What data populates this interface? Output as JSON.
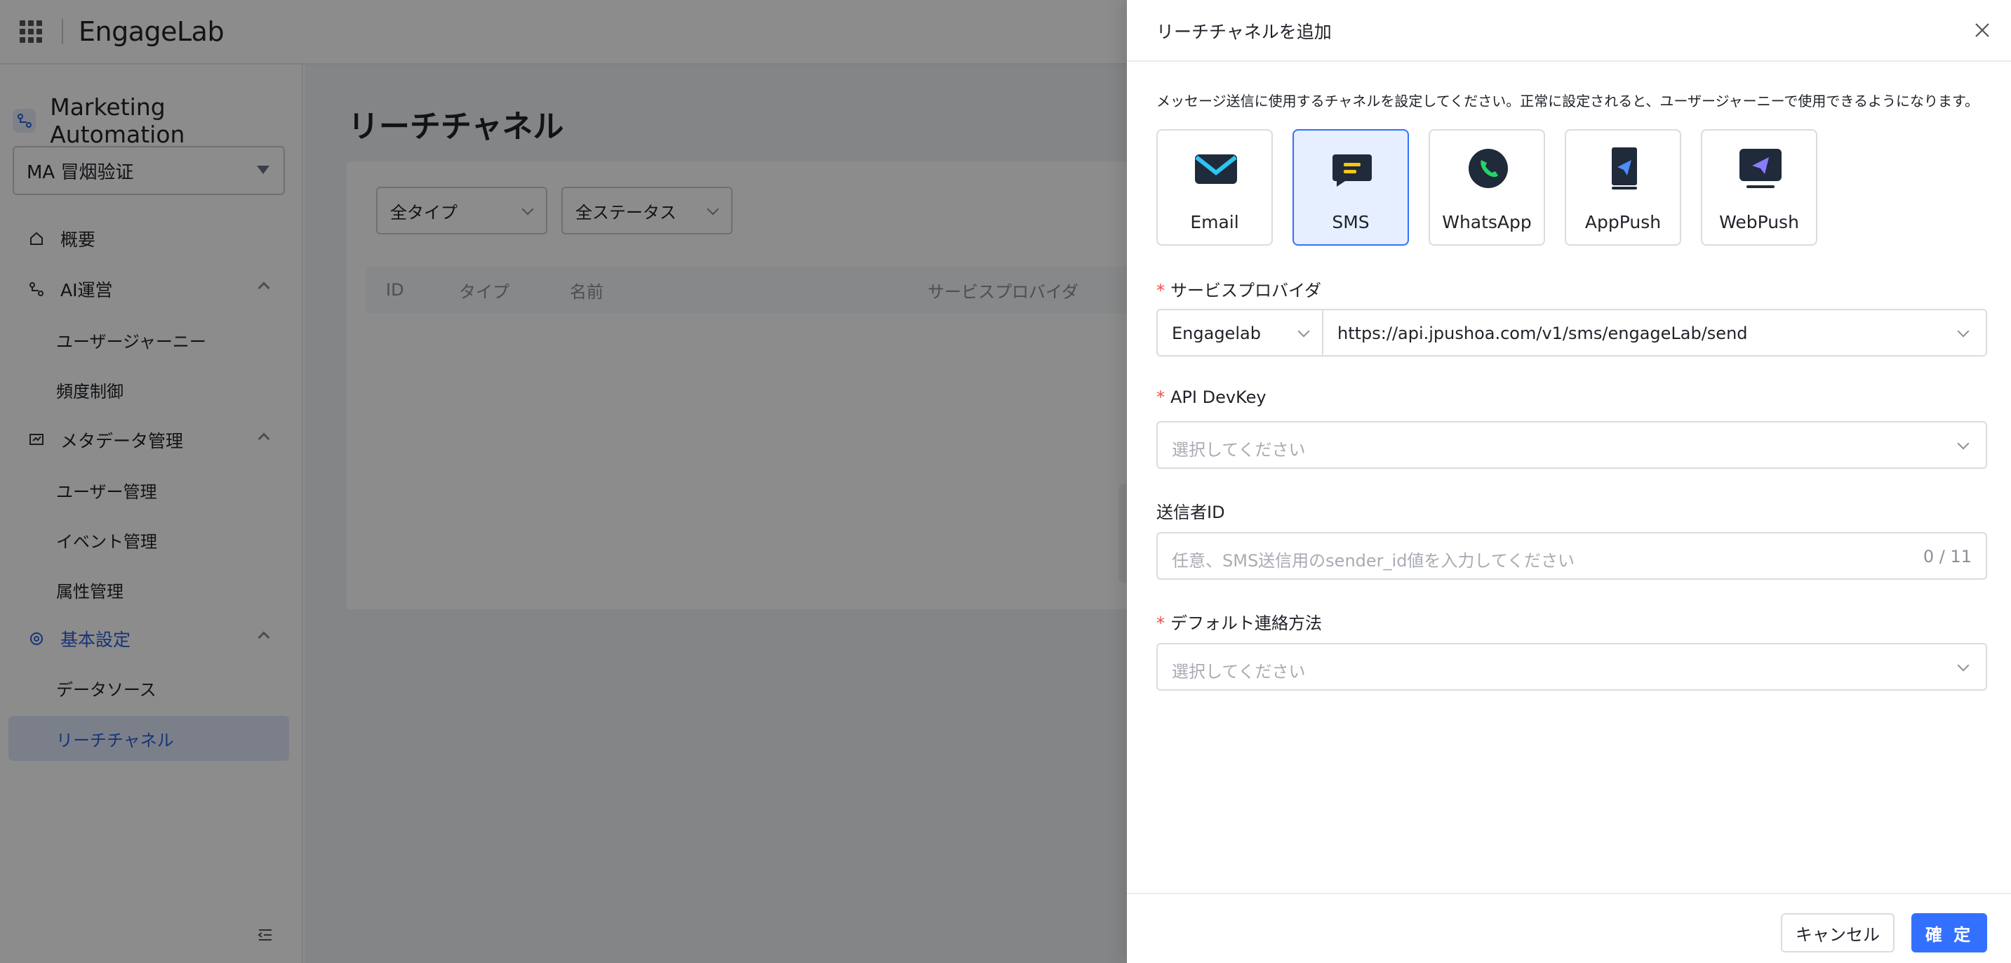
{
  "topbar": {
    "brand": "EngageLab"
  },
  "sidebar": {
    "app_title": "Marketing Automation",
    "project_select": "MA 冒烟验证",
    "items": [
      {
        "label": "概要"
      },
      {
        "label": "AI運営",
        "children": [
          "ユーザージャーニー",
          "頻度制御"
        ]
      },
      {
        "label": "メタデータ管理",
        "children": [
          "ユーザー管理",
          "イベント管理",
          "属性管理"
        ]
      },
      {
        "label": "基本設定",
        "children": [
          "データソース",
          "リーチチャネル"
        ]
      }
    ]
  },
  "main": {
    "title": "リーチチャネル",
    "filters": [
      "全タイプ",
      "全ステータス"
    ],
    "columns": [
      "ID",
      "タイプ",
      "名前",
      "サービスプロバイダ"
    ]
  },
  "drawer": {
    "title": "リーチチャネルを追加",
    "description": "メッセージ送信に使用するチャネルを設定してください。正常に設定されると、ユーザージャーニーで使用できるようになります。",
    "channels": [
      {
        "label": "Email",
        "icon": "email-icon",
        "selected": false
      },
      {
        "label": "SMS",
        "icon": "sms-icon",
        "selected": true
      },
      {
        "label": "WhatsApp",
        "icon": "whatsapp-icon",
        "selected": false
      },
      {
        "label": "AppPush",
        "icon": "apppush-icon",
        "selected": false
      },
      {
        "label": "WebPush",
        "icon": "webpush-icon",
        "selected": false
      }
    ],
    "provider": {
      "label": "サービスプロバイダ",
      "name": "Engagelab",
      "endpoint": "https://api.jpushoa.com/v1/sms/engageLab/send"
    },
    "devkey": {
      "label": "API DevKey",
      "placeholder": "選択してください"
    },
    "sender": {
      "label": "送信者ID",
      "placeholder": "任意、SMS送信用のsender_id値を入力してください",
      "count": "0 / 11"
    },
    "contact": {
      "label": "デフォルト連絡方法",
      "placeholder": "選択してください"
    },
    "footer": {
      "cancel": "キャンセル",
      "ok": "確 定"
    }
  },
  "colors": {
    "accent": "#3370ff",
    "selected_bg": "#e6efff",
    "required": "#f54a45"
  }
}
